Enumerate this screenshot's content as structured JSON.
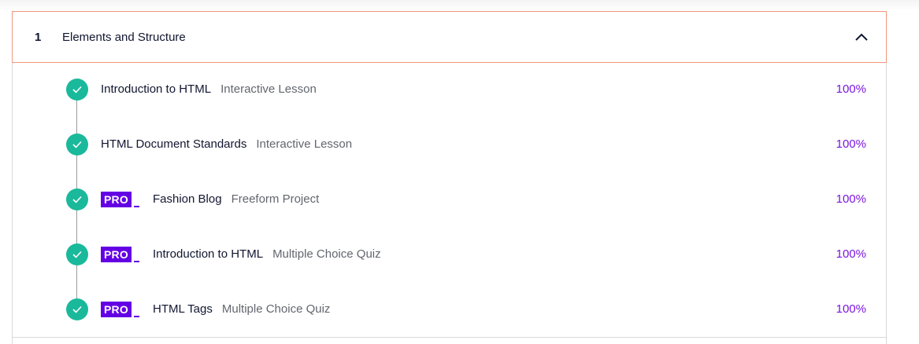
{
  "module": {
    "number": "1",
    "title": "Elements and Structure",
    "expanded": true
  },
  "items": [
    {
      "title": "Introduction to HTML",
      "type": "Interactive Lesson",
      "percent": "100%",
      "pro": false,
      "completed": true
    },
    {
      "title": "HTML Document Standards",
      "type": "Interactive Lesson",
      "percent": "100%",
      "pro": false,
      "completed": true
    },
    {
      "title": "Fashion Blog",
      "type": "Freeform Project",
      "percent": "100%",
      "pro": true,
      "pro_label": "PRO",
      "completed": true
    },
    {
      "title": "Introduction to HTML",
      "type": "Multiple Choice Quiz",
      "percent": "100%",
      "pro": true,
      "pro_label": "PRO",
      "completed": true
    },
    {
      "title": "HTML Tags",
      "type": "Multiple Choice Quiz",
      "percent": "100%",
      "pro": true,
      "pro_label": "PRO",
      "completed": true
    }
  ],
  "colors": {
    "check": "#1ab99b",
    "pro": "#6400e4",
    "percent": "#7a14e0",
    "header_border": "#f2977b",
    "text": "#10162f",
    "subtext": "#62666e"
  },
  "icons": {
    "collapse": "chevron-up-icon",
    "complete": "check-circle-icon"
  }
}
